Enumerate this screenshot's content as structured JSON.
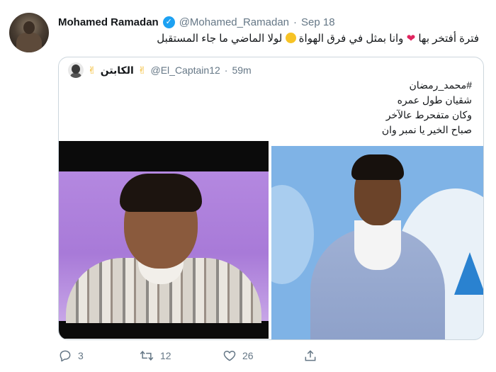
{
  "tweet": {
    "author": {
      "display_name": "Mohamed Ramadan",
      "handle": "@Mohamed_Ramadan",
      "verified_icon": "verified-badge-icon"
    },
    "separator": "·",
    "date": "Sep 18",
    "text_part1": "فترة أفتخر بها",
    "heart_emoji": "❤",
    "text_part2": "وانا بمثل في فرق الهواة",
    "text_part3": "لولا الماضي ما جاء المستقبل"
  },
  "quote": {
    "author": {
      "display_name": "الكابتن",
      "victory_emoji": "✌",
      "handle": "@El_Captain12",
      "separator": "·",
      "time": "59m"
    },
    "lines": [
      "#محمد_رمضان",
      "شقيان طول عمره",
      "وكان متفحرط عالآخر",
      "صباح الخير يا نمبر وان"
    ]
  },
  "actions": {
    "reply_count": "3",
    "retweet_count": "12",
    "like_count": "26",
    "icons": [
      "reply-icon",
      "retweet-icon",
      "like-icon",
      "share-icon"
    ]
  },
  "colors": {
    "link_gray": "#657786",
    "verified_blue": "#1da1f2",
    "heart_red": "#e0245e",
    "border": "#ccd6dd"
  }
}
